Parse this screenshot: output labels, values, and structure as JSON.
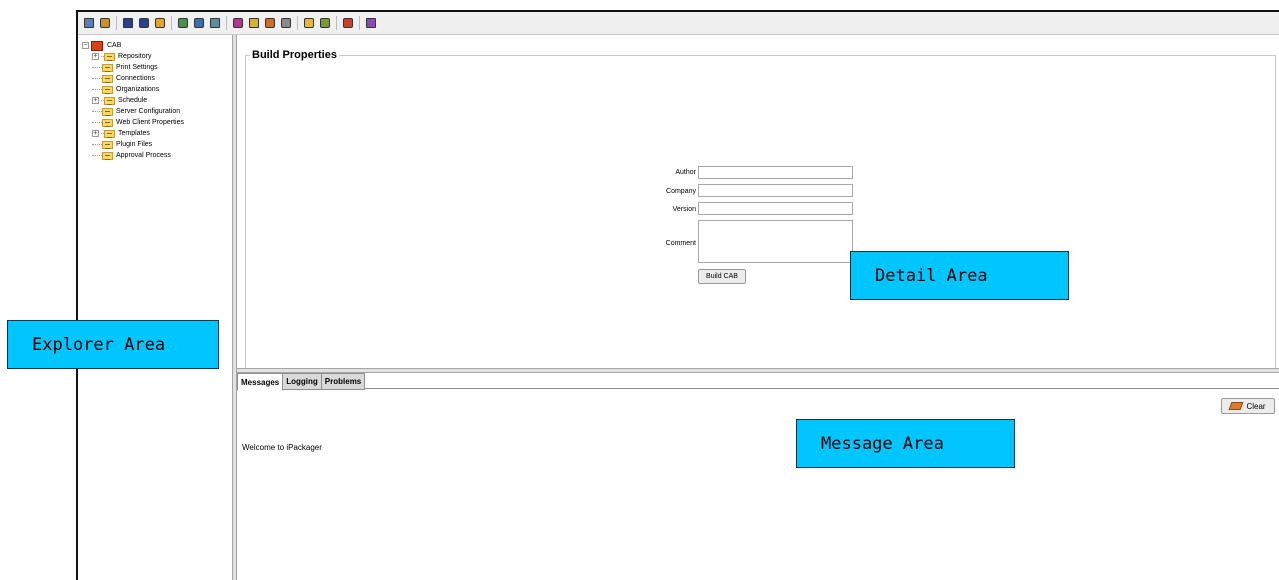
{
  "toolbar": {
    "buttons": [
      {
        "icon": "new-icon",
        "color": "#5a7fb5"
      },
      {
        "icon": "open-icon",
        "color": "#c88f2a"
      },
      {
        "sep": true
      },
      {
        "icon": "save-icon",
        "color": "#2a3f8f"
      },
      {
        "icon": "save-all-icon",
        "color": "#2a3f8f"
      },
      {
        "icon": "folder-open-icon",
        "color": "#e6a32a"
      },
      {
        "sep": true
      },
      {
        "icon": "tree-icon",
        "color": "#4a8f4a"
      },
      {
        "icon": "refresh-icon",
        "color": "#3a6fb5"
      },
      {
        "icon": "import-icon",
        "color": "#5a8f9a"
      },
      {
        "sep": true
      },
      {
        "icon": "export-icon",
        "color": "#b53a8f"
      },
      {
        "icon": "document-icon",
        "color": "#d4b23a"
      },
      {
        "icon": "run-icon",
        "color": "#d46a2a"
      },
      {
        "icon": "properties-icon",
        "color": "#8a8a8a"
      },
      {
        "sep": true
      },
      {
        "icon": "new-folder-icon",
        "color": "#e6b83a"
      },
      {
        "icon": "edit-icon",
        "color": "#7a9a3a"
      },
      {
        "sep": true
      },
      {
        "icon": "package-icon",
        "color": "#c8402a"
      },
      {
        "sep": true
      },
      {
        "icon": "plugin-icon",
        "color": "#8a4ab5"
      }
    ]
  },
  "explorer": {
    "root": "CAB",
    "items": [
      {
        "label": "Repository",
        "expandable": true
      },
      {
        "label": "Print Settings",
        "expandable": false
      },
      {
        "label": "Connections",
        "expandable": false
      },
      {
        "label": "Organizations",
        "expandable": false
      },
      {
        "label": "Schedule",
        "expandable": true
      },
      {
        "label": "Server Configuration",
        "expandable": false
      },
      {
        "label": "Web Client Properties",
        "expandable": false
      },
      {
        "label": "Templates",
        "expandable": true
      },
      {
        "label": "Plugin Files",
        "expandable": false
      },
      {
        "label": "Approval Process",
        "expandable": false
      }
    ]
  },
  "detail": {
    "title": "Build Properties",
    "fields": {
      "author": {
        "label": "Author",
        "value": ""
      },
      "company": {
        "label": "Company",
        "value": ""
      },
      "version": {
        "label": "Version",
        "value": ""
      },
      "comment": {
        "label": "Comment",
        "value": ""
      }
    },
    "build_button": "Build CAB"
  },
  "messages": {
    "tabs": [
      "Messages",
      "Logging",
      "Problems"
    ],
    "active_tab": "Messages",
    "clear_button": "Clear",
    "welcome": "Welcome to iPackager"
  },
  "callouts": {
    "explorer": "Explorer Area",
    "detail": "Detail Area",
    "message": "Message Area",
    "color": "#00c6ff"
  }
}
